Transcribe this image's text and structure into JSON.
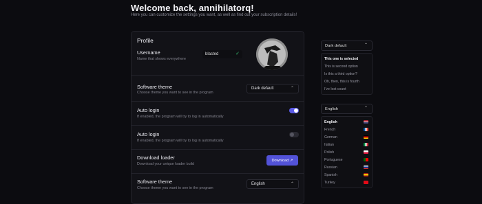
{
  "header": {
    "title": "Welcome back, annihilatorq!",
    "subtitle": "Here you can customize the settings you want, as well as find out your subscription details!"
  },
  "profile": {
    "heading": "Profile",
    "username_title": "Username",
    "username_desc": "Name that shows everywhere",
    "username_value": "blasted"
  },
  "rows": {
    "theme_title": "Software theme",
    "theme_desc": "Choose theme you want to see in the program",
    "theme_value": "Dark default",
    "autologin1_title": "Auto login",
    "autologin1_desc": "If enabled, the program will try to log in automatically",
    "autologin2_title": "Auto login",
    "autologin2_desc": "If enabled, the program will try to log in automatically",
    "download_title": "Download loader",
    "download_desc": "Download your unique loader build",
    "download_label": "Download ↗",
    "theme2_title": "Software theme",
    "theme2_desc": "Choose theme you want to see in the program",
    "theme2_value": "English"
  },
  "toggles": {
    "autologin1": true,
    "autologin2": false
  },
  "side_theme": {
    "selected": "Dark default",
    "options": [
      "This one is selected",
      "This is second option",
      "Is this a third option?",
      "Oh, then, this is fourth",
      "I've lost count"
    ]
  },
  "side_lang": {
    "selected": "English",
    "options": [
      "English",
      "French",
      "German",
      "Italian",
      "Polish",
      "Portuguese",
      "Russian",
      "Spanish",
      "Turkey"
    ]
  },
  "colors": {
    "accent": "#5b5be6",
    "check": "#3ad07a"
  }
}
